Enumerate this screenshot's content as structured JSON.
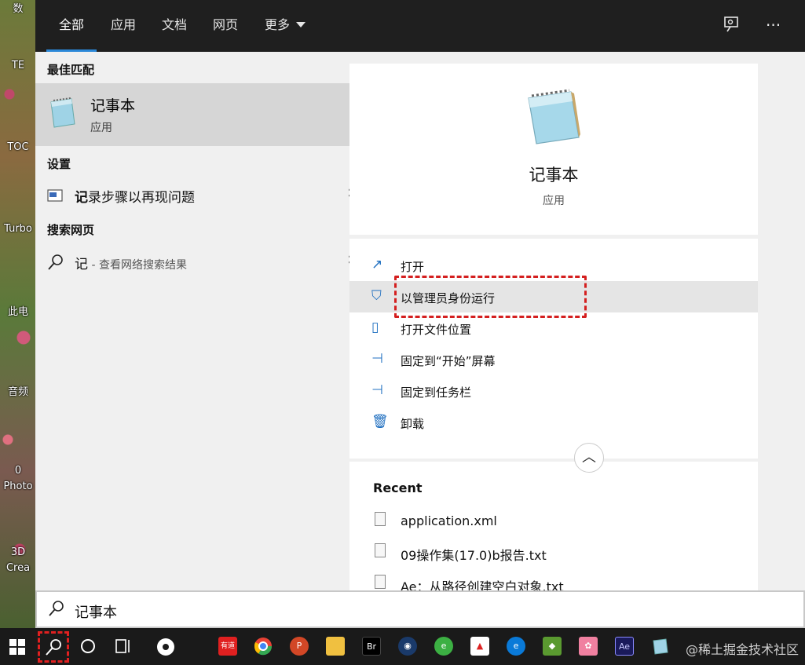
{
  "desktop": {
    "icons": [
      "数",
      "TE",
      "TOC",
      "Turbo",
      "此电",
      "音频",
      "0",
      "Photo",
      "3D",
      "Crea"
    ]
  },
  "tabs": [
    "全部",
    "应用",
    "文档",
    "网页",
    "更多"
  ],
  "best_match": {
    "section": "最佳匹配",
    "name": "记事本",
    "type": "应用"
  },
  "settings": {
    "section": "设置",
    "item_bold": "记",
    "item_rest": "录步骤以再现问题"
  },
  "web": {
    "section": "搜索网页",
    "query": "记",
    "hint": " - 查看网络搜索结果"
  },
  "detail": {
    "name": "记事本",
    "type": "应用"
  },
  "actions": [
    "打开",
    "以管理员身份运行",
    "打开文件位置",
    "固定到“开始”屏幕",
    "固定到任务栏",
    "卸载"
  ],
  "recent": {
    "title": "Recent",
    "files": [
      "application.xml",
      "09操作集(17.0)b报告.txt",
      "Ae：从路径创建空白对象.txt"
    ]
  },
  "search": {
    "value": "记事本"
  },
  "taskbar": {
    "app_labels": [
      "有道",
      "Br",
      "Ae"
    ],
    "watermark": "@稀土掘金技术社区"
  },
  "colors": {
    "accent": "#2b88d8",
    "highlight_box": "#d41f1f",
    "topbar": "#1f1f1f"
  }
}
